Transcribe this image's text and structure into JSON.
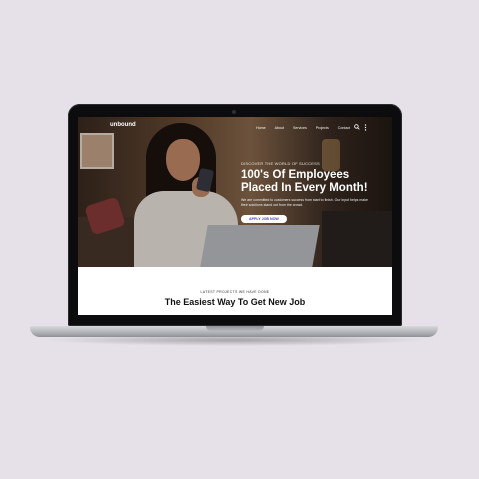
{
  "site": {
    "logo": "unbound",
    "nav": [
      "Home",
      "About",
      "Services",
      "Projects",
      "Contact"
    ],
    "icons": [
      "search-icon",
      "more-vertical-icon"
    ]
  },
  "hero": {
    "kicker": "DISCOVER THE WORLD OF SUCCESS",
    "headline_line1": "100's Of Employees",
    "headline_line2": "Placed In Every Month!",
    "subtext": "We are committed to customers success from start to finish. Our input helps make their solutions stand out from the crowd.",
    "cta": "APPLY JOB NOW"
  },
  "section": {
    "kicker": "LATEST PROJECTS WE HAVE DONE",
    "title": "The Easiest Way To Get New Job"
  },
  "colors": {
    "background": "#e6e1e8",
    "accent": "#4b3ac9"
  }
}
